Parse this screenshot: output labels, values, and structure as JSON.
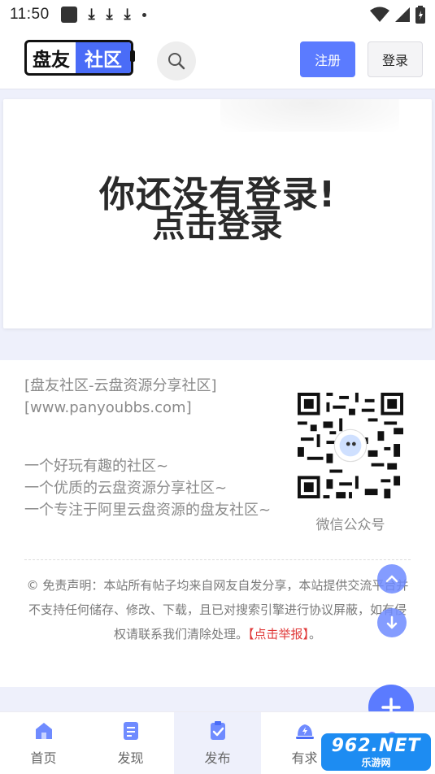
{
  "status_bar": {
    "time": "11:50"
  },
  "header": {
    "logo_part1": "盘友",
    "logo_part2": "社区",
    "register_label": "注册",
    "login_label": "登录"
  },
  "login_prompt": {
    "line1": "你还没有登录!",
    "line2": "点击登录"
  },
  "footer": {
    "site_name": "[盘友社区-云盘资源分享社区]",
    "site_url": "[www.panyoubbs.com]",
    "taglines": [
      "一个好玩有趣的社区~",
      "一个优质的云盘资源分享社区~",
      "一个专注于阿里云盘资源的盘友社区~"
    ],
    "qr_caption": "微信公众号",
    "disclaimer_text": "© 免责声明：本站所有帖子均来自网友自发分享，本站提供交流平台并不支持任何储存、修改、下载，且已对搜索引擎进行协议屏蔽，如有侵权请联系我们清除处理。",
    "report_link": "【点击举报】",
    "disclaimer_end": "。"
  },
  "bottom_nav": {
    "items": [
      {
        "label": "首页",
        "icon": "home-icon"
      },
      {
        "label": "发现",
        "icon": "discover-icon"
      },
      {
        "label": "发布",
        "icon": "publish-icon"
      },
      {
        "label": "有求",
        "icon": "request-icon"
      },
      {
        "label": "",
        "icon": "profile-icon"
      }
    ]
  },
  "watermark": {
    "top": "962.NET",
    "bottom": "乐游网"
  },
  "colors": {
    "accent": "#5b7bff",
    "band": "#eef0fb",
    "report": "#e03a3a"
  }
}
